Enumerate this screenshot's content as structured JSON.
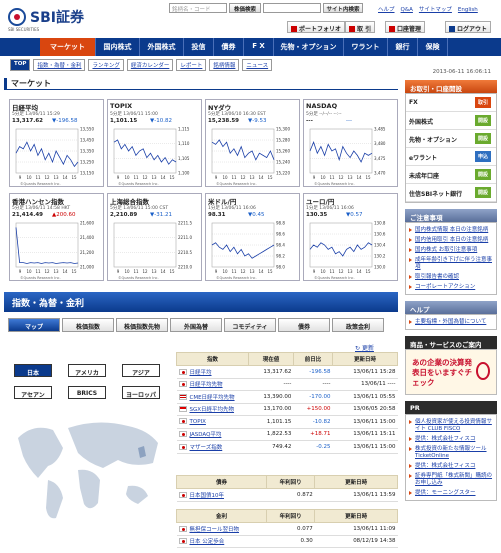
{
  "header": {
    "logo_text": "SBI証券",
    "logo_sub": "SBI SECURITIES",
    "search_placeholder": "銘柄名・コード",
    "stock_search_label": "株価検索",
    "site_search_label": "サイト内検索",
    "top_links": [
      "ヘルプ",
      "Q&A",
      "サイトマップ",
      "English"
    ],
    "buttons": [
      "ポートフォリオ",
      "取 引",
      "口座管理",
      "ログアウト"
    ]
  },
  "nav": {
    "items": [
      "マーケット",
      "国内株式",
      "外国株式",
      "投信",
      "債券",
      "F X",
      "先物・オプション",
      "ワラント",
      "銀行",
      "保険"
    ]
  },
  "subnav": {
    "items": [
      "TOP",
      "指数・為替・金利",
      "ランキング",
      "経済カレンダー",
      "レポート",
      "銘柄情報",
      "ニュース"
    ]
  },
  "timestamp": "2013-06-11 16:06:11",
  "section_title": "マーケット",
  "market_tabs": [
    "TOP",
    "指数・為替・金利",
    "ランキング",
    "経済カレンダー",
    "レポート",
    "銘柄情報",
    "ニュース"
  ],
  "mini_charts": [
    {
      "name": "日経平均",
      "sub": "5分足 13/06/11 15:29",
      "value": "13,317.62",
      "change": "▼-196.58",
      "dir": "dn",
      "axis": [
        "13,550",
        "13,450",
        "13,350",
        "13,250",
        "13,150"
      ],
      "xaxis": [
        "9",
        "10",
        "11",
        "12",
        "13",
        "14",
        "15"
      ],
      "points": [
        0.55,
        0.4,
        0.45,
        0.3,
        0.5,
        0.35,
        0.6,
        0.45,
        0.7,
        0.55,
        0.75,
        0.5,
        0.65,
        0.8,
        0.6,
        0.7,
        0.85,
        0.75
      ]
    },
    {
      "name": "TOPIX",
      "sub": "5分足 13/06/11 15:00",
      "value": "1,101.15",
      "change": "▼-10.82",
      "dir": "dn",
      "axis": [
        "1,115",
        "1,110",
        "1,105",
        "1,100"
      ],
      "xaxis": [
        "9",
        "10",
        "11",
        "12",
        "13",
        "14",
        "15"
      ],
      "points": [
        0.3,
        0.25,
        0.45,
        0.35,
        0.5,
        0.4,
        0.6,
        0.5,
        0.45,
        0.65,
        0.55,
        0.7,
        0.6,
        0.75,
        0.65,
        0.8,
        0.7,
        0.75
      ]
    },
    {
      "name": "NYダウ",
      "sub": "5分足 13/06/10 16:30 EST",
      "value": "15,238.59",
      "change": "▼-9.53",
      "dir": "dn",
      "axis": [
        "15,300",
        "15,280",
        "15,260",
        "15,240",
        "15,220"
      ],
      "xaxis": [
        "9",
        "10",
        "11",
        "12",
        "13",
        "14",
        "15"
      ],
      "points": [
        0.3,
        0.35,
        0.25,
        0.4,
        0.3,
        0.55,
        0.45,
        0.6,
        0.4,
        0.65,
        0.55,
        0.5,
        0.7,
        0.55,
        0.6,
        0.65,
        0.5,
        0.7
      ]
    },
    {
      "name": "NASDAQ",
      "sub": "5分足 --/--/-- --:--",
      "value": "---",
      "change": "---",
      "dir": "dn",
      "axis": [
        "3,485",
        "3,480",
        "3,475",
        "3,470"
      ],
      "xaxis": [
        "9",
        "10",
        "11",
        "12",
        "13",
        "14",
        "15"
      ],
      "points": [
        0.5,
        0.3,
        0.55,
        0.4,
        0.6,
        0.35,
        0.5,
        0.45,
        0.7,
        0.4,
        0.55,
        0.65,
        0.5,
        0.6,
        0.75,
        0.55,
        0.6,
        0.55
      ]
    },
    {
      "name": "香港ハンセン指数",
      "sub": "5分足 13/06/11 14:58 HKT",
      "value": "21,414.49",
      "change": "▲200.60",
      "dir": "up",
      "axis": [
        "21,600",
        "21,400",
        "21,200",
        "21,000"
      ],
      "xaxis": [
        "9",
        "10",
        "11",
        "12",
        "13",
        "14",
        "15"
      ],
      "points": [
        0.1,
        0.9,
        0.9,
        0.92,
        0.9,
        0.91,
        0.9,
        0.92,
        0.9,
        0.91,
        0.9,
        0.92,
        0.91,
        0.9,
        0.91,
        0.9,
        0.92,
        0.91
      ]
    },
    {
      "name": "上海総合指数",
      "sub": "5分足 13/06/11 15:00 CST",
      "value": "2,210.89",
      "change": "▼-31.21",
      "dir": "dn",
      "axis": [
        "2211.5",
        "2211.0",
        "2210.5",
        "2210.0"
      ],
      "xaxis": [
        "9",
        "10",
        "11",
        "12",
        "13",
        "14",
        "15"
      ],
      "points": []
    },
    {
      "name": "米ドル/円",
      "sub": "1分足 13/06/11 16:06",
      "value": "98.31",
      "change": "▼0.45",
      "dir": "dn",
      "axis": [
        "98.8",
        "98.6",
        "98.4",
        "98.2",
        "98.0"
      ],
      "xaxis": [
        "9",
        "10",
        "11",
        "12",
        "13",
        "14",
        "15"
      ],
      "points": [
        0.5,
        0.45,
        0.55,
        0.6,
        0.5,
        0.65,
        0.55,
        0.7,
        0.6,
        0.75,
        0.7,
        0.8,
        0.75,
        0.7,
        0.65,
        0.6,
        0.55,
        0.5
      ]
    },
    {
      "name": "ユーロ/円",
      "sub": "1分足 13/06/11 16:06",
      "value": "130.35",
      "change": "▼0.57",
      "dir": "dn",
      "axis": [
        "130.8",
        "130.6",
        "130.4",
        "130.2",
        "130.0"
      ],
      "xaxis": [
        "9",
        "10",
        "11",
        "12",
        "13",
        "14",
        "15"
      ],
      "points": [
        0.6,
        0.5,
        0.55,
        0.45,
        0.5,
        0.6,
        0.55,
        0.7,
        0.65,
        0.75,
        0.6,
        0.55,
        0.65,
        0.5,
        0.6,
        0.55,
        0.45,
        0.5
      ]
    }
  ],
  "copyright": "©Quants Research Inc.",
  "band_title": "指数・為替・金利",
  "content_tabs": [
    "マップ",
    "株価指数",
    "株価指数先物",
    "外国為替",
    "コモディティ",
    "債券",
    "政策金利"
  ],
  "update_label": "更新",
  "regions": [
    "日本",
    "アメリカ",
    "アジア",
    "アセアン",
    "BRICS",
    "ヨーロッパ"
  ],
  "index_table": {
    "headers": [
      "指数",
      "現在値",
      "前日比",
      "更新日時"
    ],
    "rows": [
      {
        "flag": "jp",
        "name": "日経平均",
        "value": "13,317.62",
        "change": "-196.58",
        "dir": "blue",
        "time": "13/06/11 15:28"
      },
      {
        "flag": "jp",
        "name": "日経平均先物",
        "value": "----",
        "change": "----",
        "dir": "",
        "time": "13/06/11 ----"
      },
      {
        "flag": "us",
        "name": "CME日経平均先物",
        "value": "13,390.00",
        "change": "-170.00",
        "dir": "blue",
        "time": "13/06/11 05:55"
      },
      {
        "flag": "sg",
        "name": "SGX日経平均先物",
        "value": "13,170.00",
        "change": "+150.00",
        "dir": "red",
        "time": "13/06/05 20:58"
      },
      {
        "flag": "jp",
        "name": "TOPIX",
        "value": "1,101.15",
        "change": "-10.82",
        "dir": "blue",
        "time": "13/06/11 15:00"
      },
      {
        "flag": "jp",
        "name": "JASDAQ平均",
        "value": "1,822.53",
        "change": "+18.71",
        "dir": "red",
        "time": "13/06/11 15:11"
      },
      {
        "flag": "jp",
        "name": "マザーズ指数",
        "value": "749.42",
        "change": "-0.25",
        "dir": "blue",
        "time": "13/06/11 15:00"
      }
    ]
  },
  "bond_table": {
    "headers": [
      "債券",
      "年利回り",
      "更新日時"
    ],
    "rows": [
      {
        "flag": "jp",
        "name": "日本国債10年",
        "value": "0.872",
        "time": "13/06/11 13:59"
      }
    ]
  },
  "rate_table": {
    "headers": [
      "金利",
      "年利回り",
      "更新日時"
    ],
    "rows": [
      {
        "flag": "jp",
        "name": "無担保コール翌日物",
        "value": "0.077",
        "time": "13/06/11 11:09"
      },
      {
        "flag": "jp",
        "name": "日本 公定歩合",
        "value": "0.30",
        "time": "08/12/19 14:38"
      }
    ]
  },
  "right": {
    "account_head": "お取引・口座開設",
    "rows": [
      {
        "label": "FX",
        "btn": "取引",
        "color": "red"
      },
      {
        "label": "外国株式",
        "btn": "開設",
        "color": "grn"
      },
      {
        "label": "先物・オプション",
        "btn": "開設",
        "color": "grn"
      },
      {
        "label": "eワラント",
        "btn": "申込",
        "color": "blu"
      },
      {
        "label": "未成年口座",
        "btn": "開設",
        "color": "grn"
      },
      {
        "label": "住信SBIネット銀行",
        "btn": "開設",
        "color": "grn"
      }
    ],
    "notice_head": "ご注意事項",
    "notices": [
      "国内株式情報 本日の注意銘柄",
      "国内信用取引 本日の注意銘柄",
      "国内株式 お取引注意事項",
      "成年年齢引き下げに伴う注意事項",
      "取引報告書の確認",
      "コーポレートアクション"
    ],
    "help_head": "ヘルプ",
    "helps": [
      "主要指標・外国為替について"
    ],
    "campaign_head": "商品・サービスのご案内",
    "banner_text": "あの企業の決算発表日をいますぐチェック",
    "pr_head": "PR",
    "prs": [
      "個人投資家が使える投資情報サイト CLUB FISCO",
      "提供：株式会社フィスコ",
      "株式投資の新たな情報ツール TicketOnline",
      "提供：株式会社フィスコ",
      "証券専門紙「株式新聞」購読のお申し込み",
      "提供：モーニングスター"
    ]
  }
}
